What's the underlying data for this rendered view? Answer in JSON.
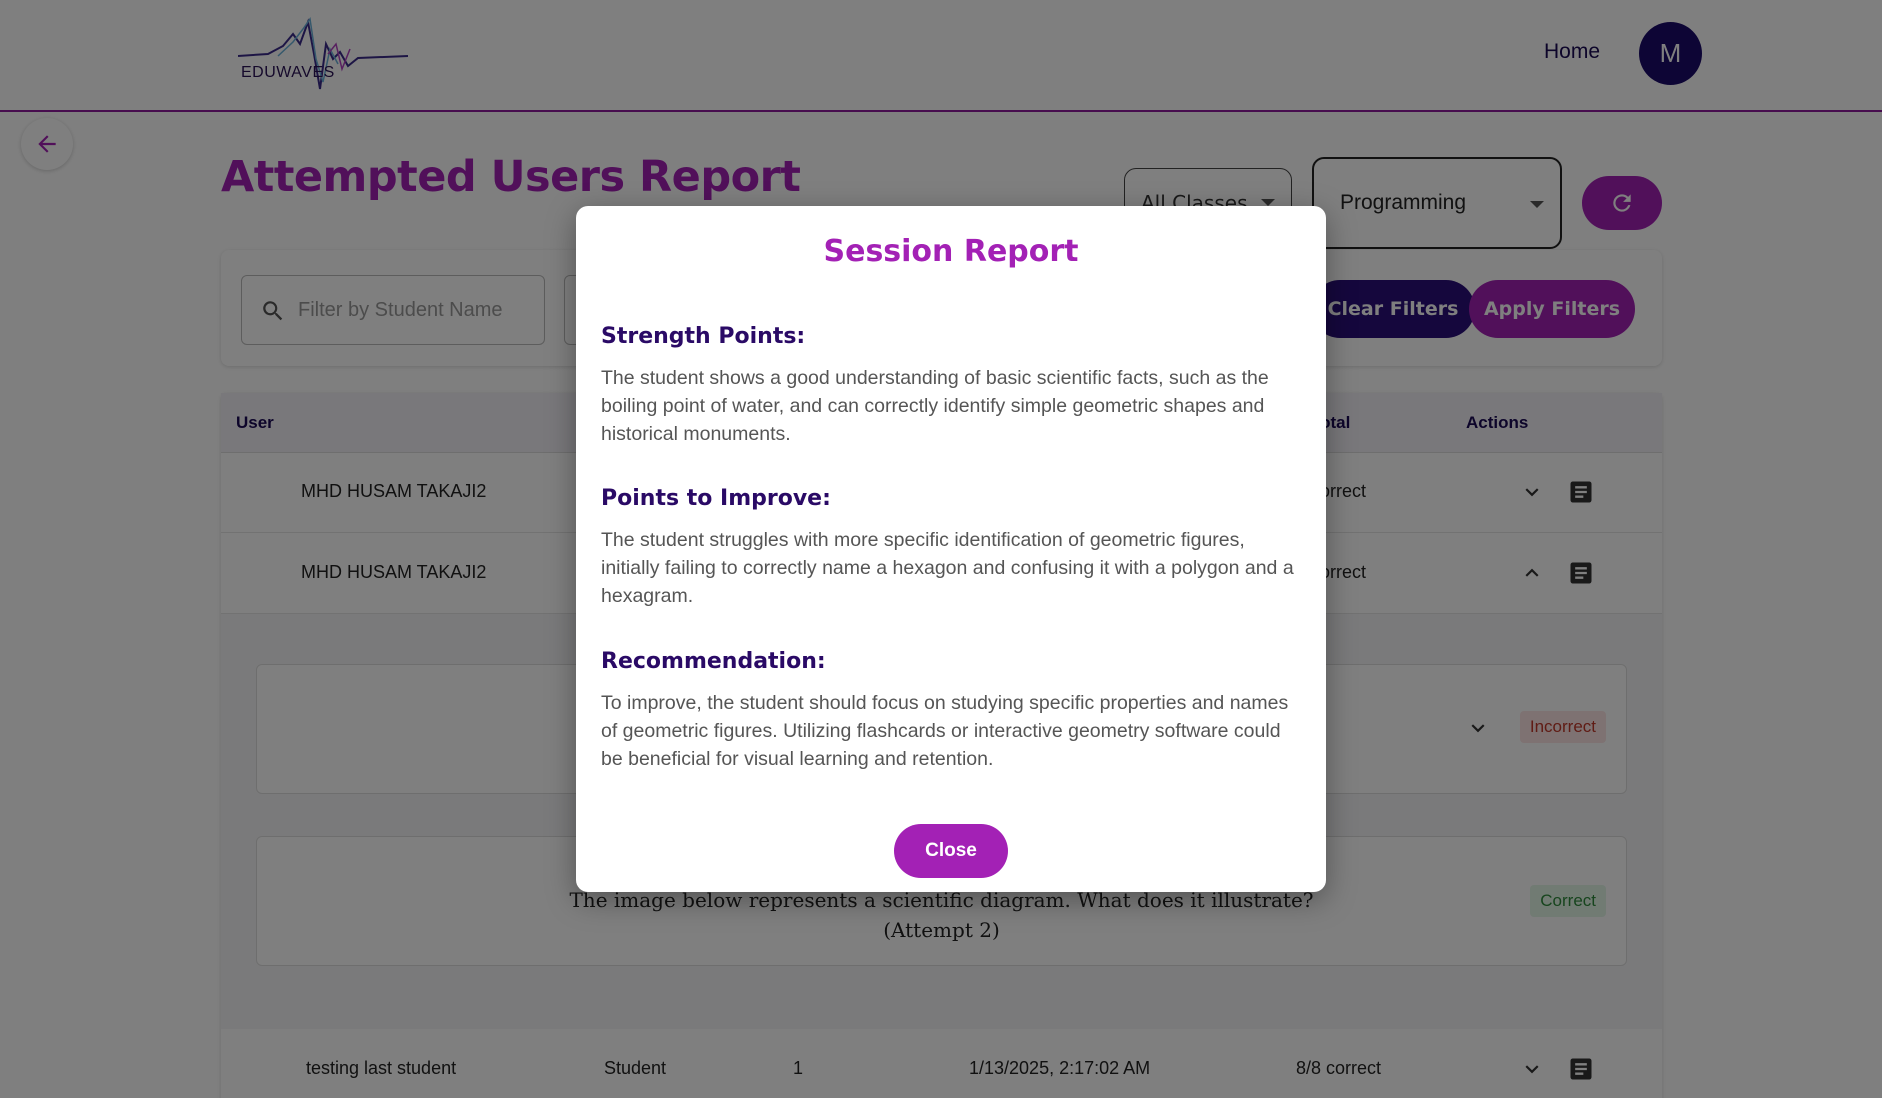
{
  "header": {
    "logo_text": "EDUWAVES",
    "nav_home": "Home",
    "avatar_initial": "M"
  },
  "page": {
    "title": "Attempted Users Report"
  },
  "filters": {
    "classes_value": "All Classes",
    "subject_value": "Programming",
    "search_placeholder": "Filter by Student Name",
    "clear_label": "Clear Filters",
    "apply_label": "Apply Filters"
  },
  "table": {
    "headers": {
      "user": "User",
      "total": "Total",
      "actions": "Actions"
    },
    "rows": [
      {
        "user": "MHD HUSAM TAKAJI2",
        "total": "correct"
      },
      {
        "user": "MHD HUSAM TAKAJI2",
        "total": "correct"
      },
      {
        "user": "testing last student",
        "role": "Student",
        "attempt": "1",
        "date": "1/13/2025, 2:17:02 AM",
        "total": "8/8 correct"
      }
    ],
    "expanded": {
      "q1_status": "Incorrect",
      "q2_text": "The image below represents a scientific diagram. What does it illustrate?",
      "q2_attempt": "(Attempt 2)",
      "q2_status": "Correct"
    }
  },
  "modal": {
    "title": "Session Report",
    "strength_title": "Strength Points:",
    "strength_body": "The student shows a good understanding of basic scientific facts, such as the boiling point of water, and can correctly identify simple geometric shapes and historical monuments.",
    "improve_title": "Points to Improve:",
    "improve_body": "The student struggles with more specific identification of geometric figures, initially failing to correctly name a hexagon and confusing it with a polygon and a hexagram.",
    "recommend_title": "Recommendation:",
    "recommend_body": "To improve, the student should focus on studying specific properties and names of geometric figures. Utilizing flashcards or interactive geometry software could be beneficial for visual learning and retention.",
    "close_label": "Close"
  },
  "colors": {
    "brand_purple": "#a321b5",
    "brand_navy": "#2a0f7a"
  }
}
